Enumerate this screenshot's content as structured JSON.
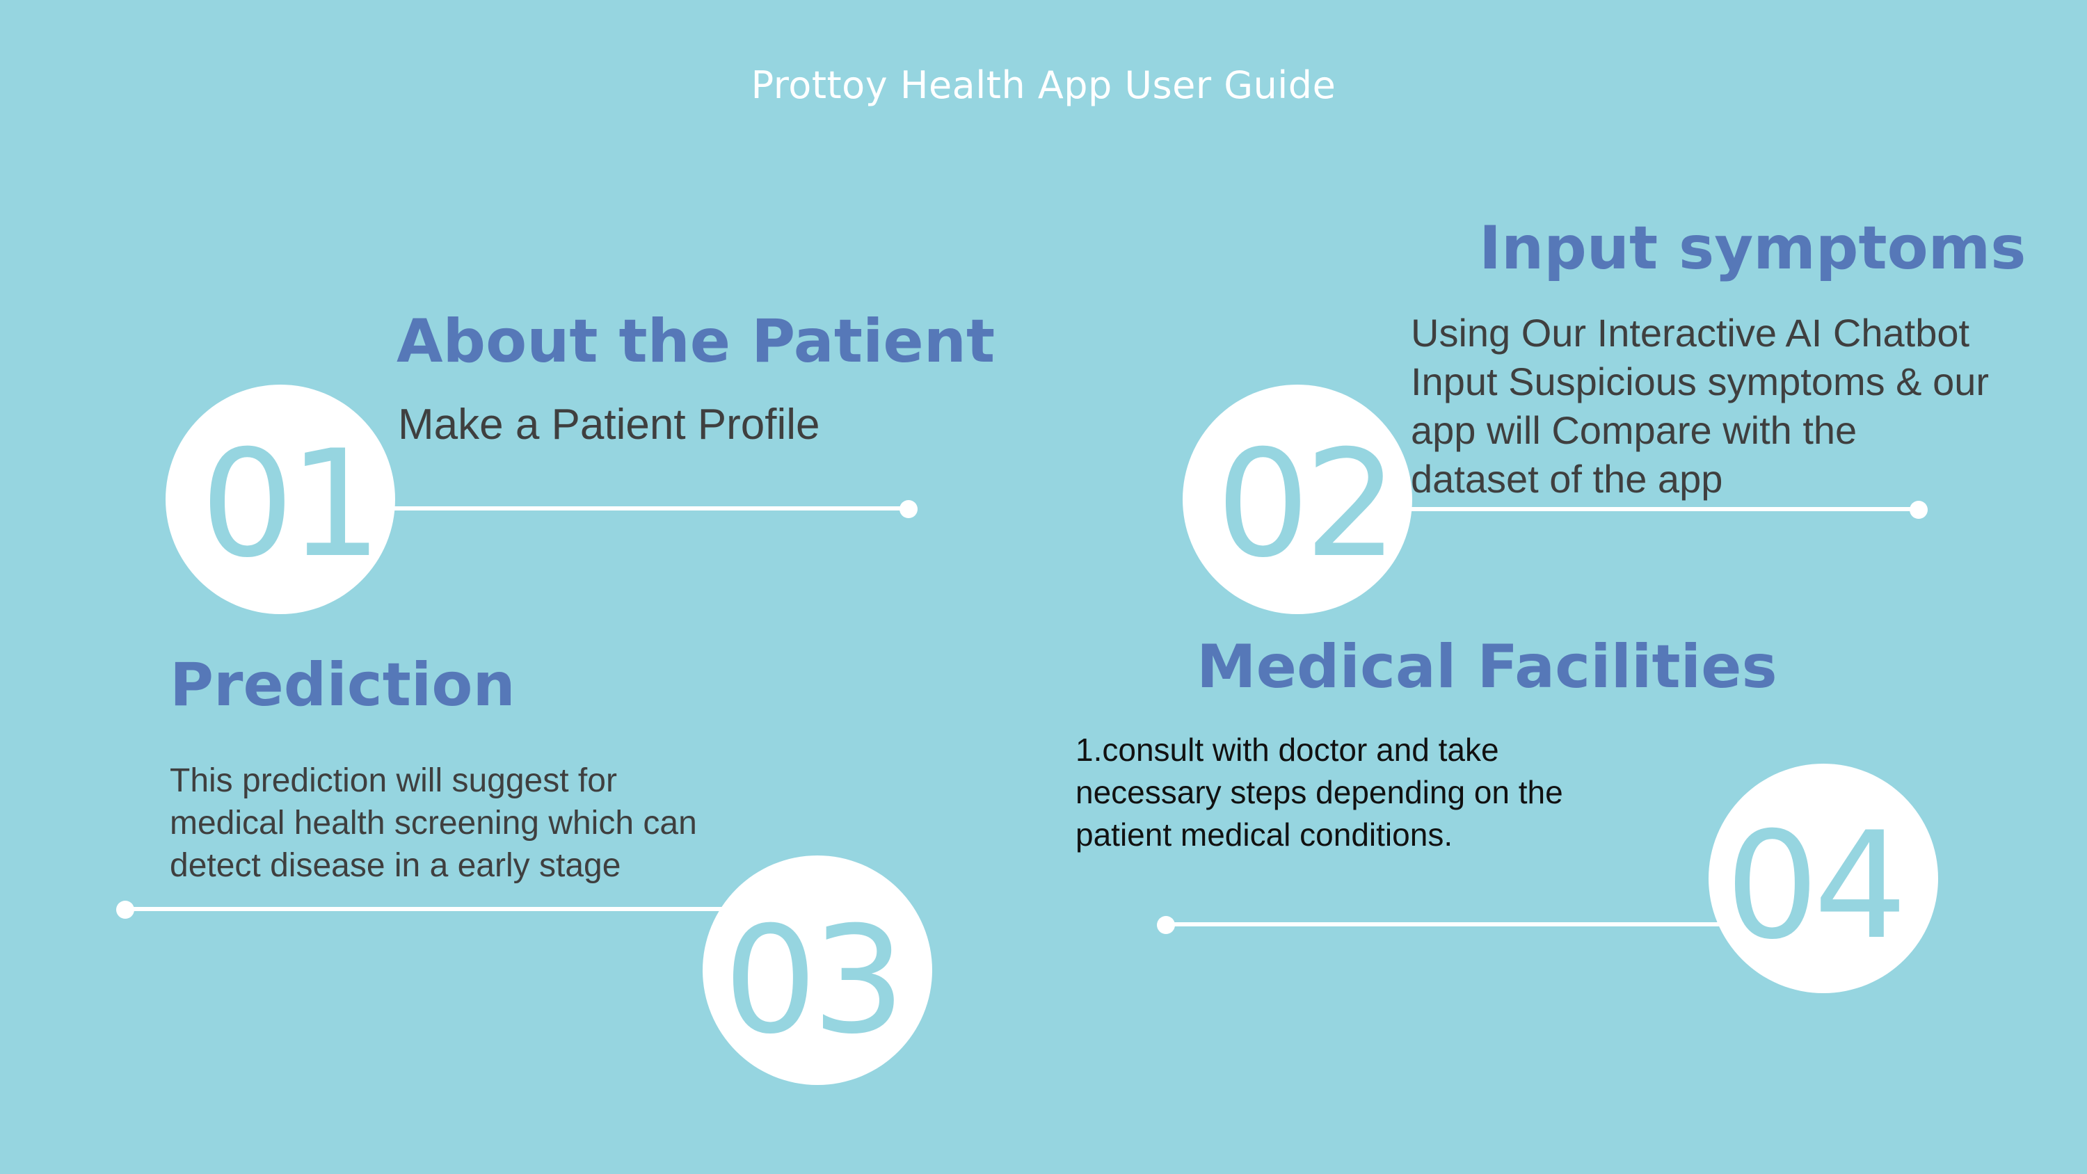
{
  "title": "Prottoy Health App User Guide",
  "colors": {
    "background": "#96d5e0",
    "heading": "#5678b8",
    "circle": "#ffffff",
    "number": "#96d5e0",
    "body_text": "#3f3f3f"
  },
  "steps": [
    {
      "number": "01",
      "heading": "About the Patient",
      "description_lines": [
        "Make a Patient  Profile"
      ]
    },
    {
      "number": "02",
      "heading": "Input symptoms",
      "description_lines": [
        "Using Our Interactive AI Chatbot",
        "Input Suspicious symptoms  & our",
        "app will  Compare with the",
        "dataset of the app"
      ]
    },
    {
      "number": "03",
      "heading": "Prediction",
      "description_lines": [
        "This prediction will suggest for",
        "medical health screening which can",
        "detect disease in a early stage"
      ]
    },
    {
      "number": "04",
      "heading": "Medical Facilities",
      "description_lines": [
        "1.consult with doctor and take",
        "necessary steps depending on the",
        "patient medical conditions."
      ]
    }
  ]
}
